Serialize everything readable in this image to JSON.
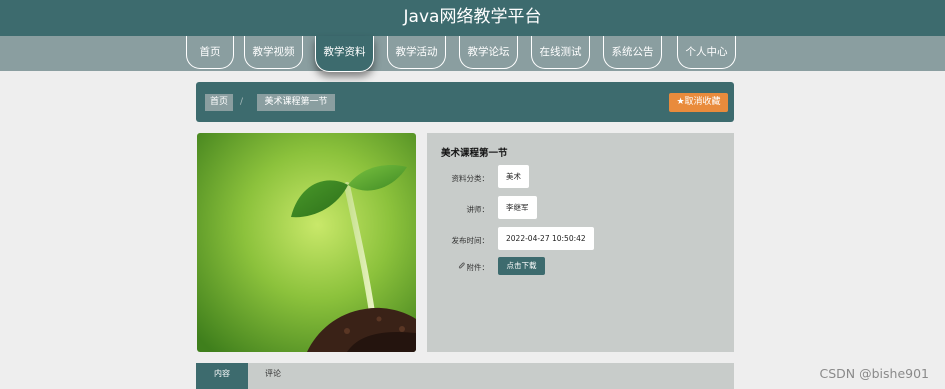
{
  "header": {
    "title": "Java网络教学平台"
  },
  "nav": {
    "items": [
      {
        "label": "首页"
      },
      {
        "label": "教学视频"
      },
      {
        "label": "教学资料"
      },
      {
        "label": "教学活动"
      },
      {
        "label": "教学论坛"
      },
      {
        "label": "在线测试"
      },
      {
        "label": "系统公告"
      },
      {
        "label": "个人中心"
      }
    ],
    "active_index": 2
  },
  "breadcrumb": {
    "home": "首页",
    "separator": "/",
    "current": "美术课程第一节"
  },
  "actions": {
    "favorite_icon": "star-icon",
    "favorite_label": "取消收藏"
  },
  "detail": {
    "title": "美术课程第一节",
    "category_label": "资料分类：",
    "category_value": "美术",
    "lecturer_label": "讲师：",
    "lecturer_value": "李继军",
    "publish_label": "发布时间：",
    "publish_value": "2022-04-27 10:50:42",
    "attachment_icon": "paperclip-icon",
    "attachment_label": "附件：",
    "download_label": "点击下载"
  },
  "tabs": [
    {
      "label": "内容"
    },
    {
      "label": "评论"
    }
  ],
  "watermark": "CSDN @bishe901",
  "colors": {
    "primary": "#3d6b6e",
    "secondary": "#8a9ea0",
    "accent": "#e98b3c",
    "panel": "#c8ccca",
    "background": "#eeeeee"
  }
}
